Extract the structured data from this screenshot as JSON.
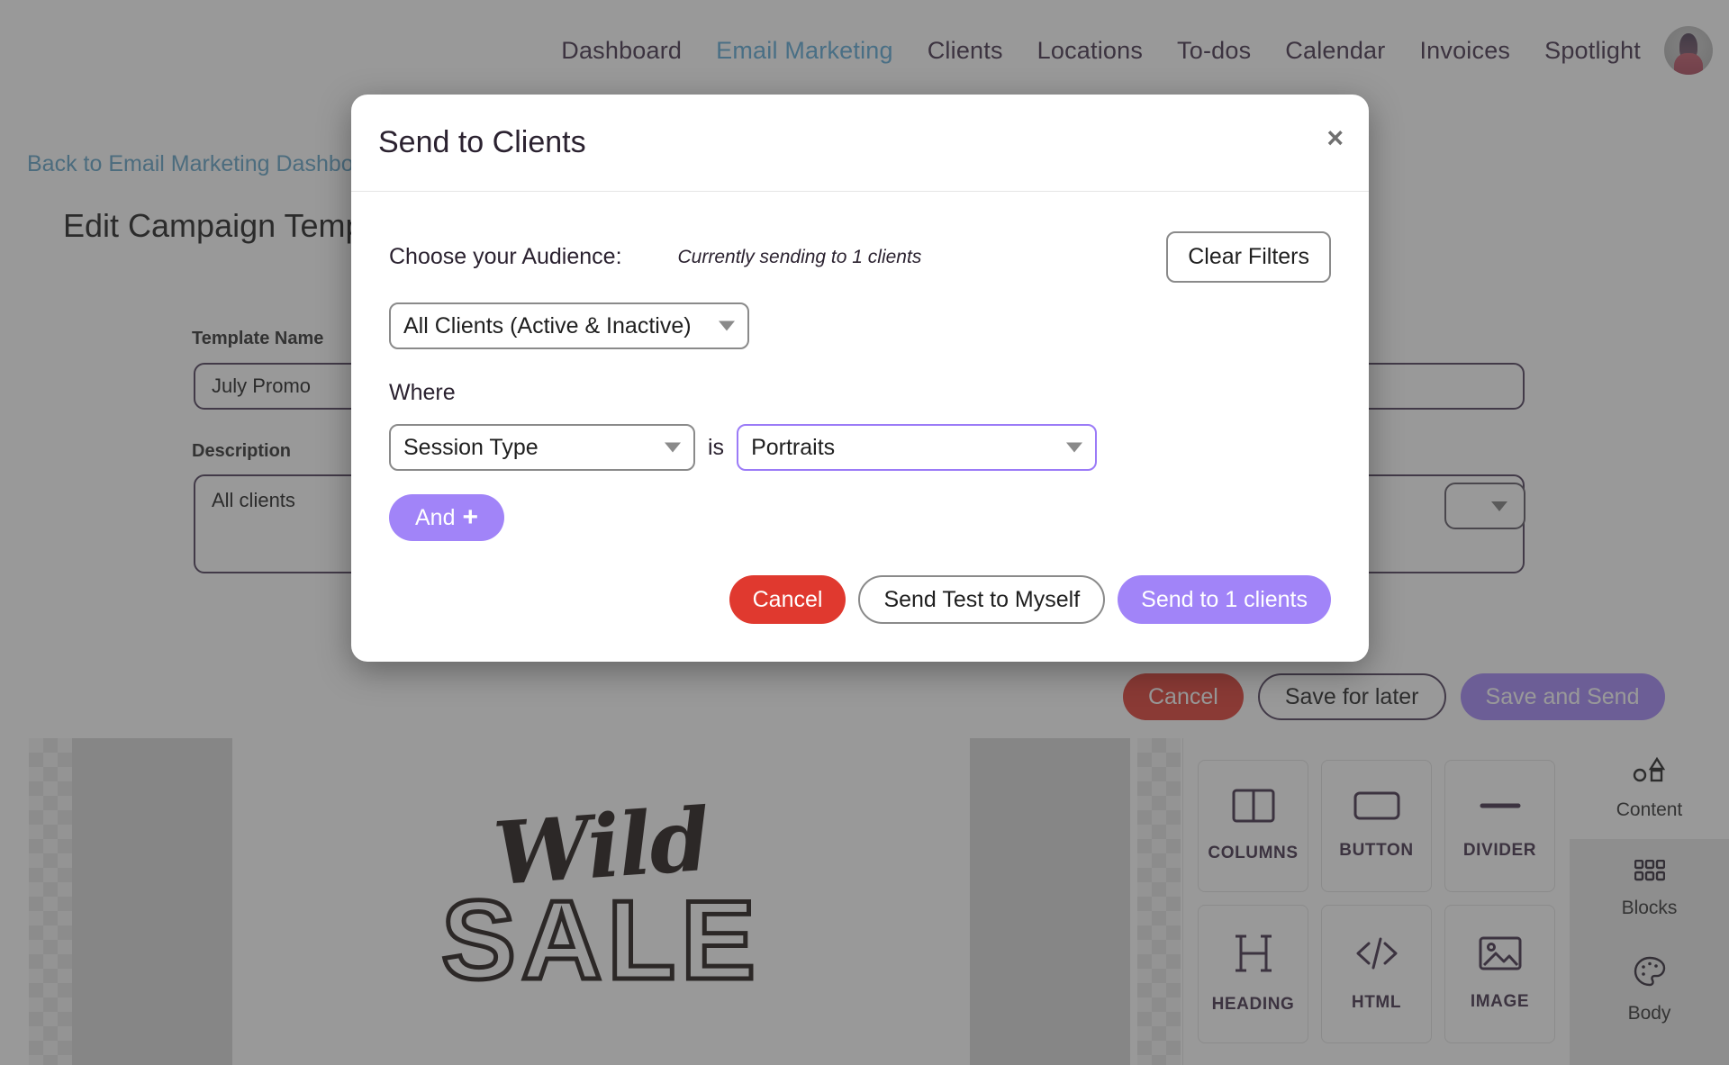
{
  "nav": {
    "items": [
      {
        "label": "Dashboard",
        "active": false
      },
      {
        "label": "Email Marketing",
        "active": true
      },
      {
        "label": "Clients",
        "active": false
      },
      {
        "label": "Locations",
        "active": false
      },
      {
        "label": "To-dos",
        "active": false
      },
      {
        "label": "Calendar",
        "active": false
      },
      {
        "label": "Invoices",
        "active": false
      },
      {
        "label": "Spotlight",
        "active": false
      }
    ],
    "avatar_name": "user-avatar"
  },
  "page": {
    "back_link": "Back to Email Marketing Dashboard",
    "title": "Edit Campaign Template",
    "template_name_label": "Template Name",
    "template_name_value": "July Promo",
    "description_label": "Description",
    "description_value": "All clients"
  },
  "bottom_actions": {
    "cancel": "Cancel",
    "save_later": "Save for later",
    "save_send": "Save and Send"
  },
  "email": {
    "headline_script": "Wild",
    "headline_block": "SALE"
  },
  "palette": {
    "cards": [
      {
        "label": "COLUMNS",
        "icon": "columns-icon"
      },
      {
        "label": "BUTTON",
        "icon": "button-icon"
      },
      {
        "label": "DIVIDER",
        "icon": "divider-icon"
      },
      {
        "label": "HEADING",
        "icon": "heading-icon"
      },
      {
        "label": "HTML",
        "icon": "html-icon"
      },
      {
        "label": "IMAGE",
        "icon": "image-icon"
      }
    ],
    "rail": [
      {
        "label": "Content",
        "icon": "shapes-icon",
        "selected": false
      },
      {
        "label": "Blocks",
        "icon": "grid-icon",
        "selected": true
      },
      {
        "label": "Body",
        "icon": "palette-icon",
        "selected": true
      }
    ]
  },
  "modal": {
    "title": "Send to Clients",
    "close_label": "×",
    "audience_label": "Choose your Audience:",
    "sending_note": "Currently sending to 1 clients",
    "clear_filters": "Clear Filters",
    "audience_value": "All Clients (Active & Inactive)",
    "where_label": "Where",
    "where_field_value": "Session Type",
    "where_is": "is",
    "where_value": "Portraits",
    "and_label": "And",
    "and_plus": "+",
    "cancel": "Cancel",
    "send_test": "Send Test to Myself",
    "send": "Send to 1 clients"
  },
  "colors": {
    "accent_purple": "#a184f8",
    "danger_red": "#e0392f",
    "link_blue": "#59a7d6",
    "focus_purple": "#9b7bf7",
    "text_dark": "#2b2230"
  }
}
